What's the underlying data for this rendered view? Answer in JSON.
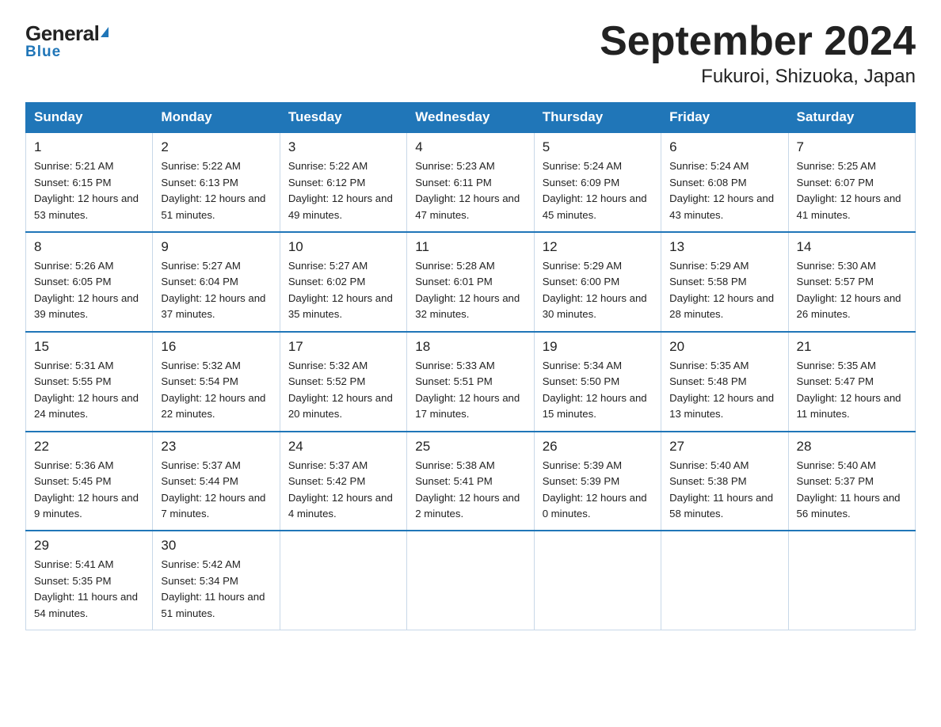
{
  "logo": {
    "general": "General",
    "blue": "Blue"
  },
  "title": "September 2024",
  "subtitle": "Fukuroi, Shizuoka, Japan",
  "days_of_week": [
    "Sunday",
    "Monday",
    "Tuesday",
    "Wednesday",
    "Thursday",
    "Friday",
    "Saturday"
  ],
  "weeks": [
    [
      {
        "num": "1",
        "sunrise": "Sunrise: 5:21 AM",
        "sunset": "Sunset: 6:15 PM",
        "daylight": "Daylight: 12 hours and 53 minutes."
      },
      {
        "num": "2",
        "sunrise": "Sunrise: 5:22 AM",
        "sunset": "Sunset: 6:13 PM",
        "daylight": "Daylight: 12 hours and 51 minutes."
      },
      {
        "num": "3",
        "sunrise": "Sunrise: 5:22 AM",
        "sunset": "Sunset: 6:12 PM",
        "daylight": "Daylight: 12 hours and 49 minutes."
      },
      {
        "num": "4",
        "sunrise": "Sunrise: 5:23 AM",
        "sunset": "Sunset: 6:11 PM",
        "daylight": "Daylight: 12 hours and 47 minutes."
      },
      {
        "num": "5",
        "sunrise": "Sunrise: 5:24 AM",
        "sunset": "Sunset: 6:09 PM",
        "daylight": "Daylight: 12 hours and 45 minutes."
      },
      {
        "num": "6",
        "sunrise": "Sunrise: 5:24 AM",
        "sunset": "Sunset: 6:08 PM",
        "daylight": "Daylight: 12 hours and 43 minutes."
      },
      {
        "num": "7",
        "sunrise": "Sunrise: 5:25 AM",
        "sunset": "Sunset: 6:07 PM",
        "daylight": "Daylight: 12 hours and 41 minutes."
      }
    ],
    [
      {
        "num": "8",
        "sunrise": "Sunrise: 5:26 AM",
        "sunset": "Sunset: 6:05 PM",
        "daylight": "Daylight: 12 hours and 39 minutes."
      },
      {
        "num": "9",
        "sunrise": "Sunrise: 5:27 AM",
        "sunset": "Sunset: 6:04 PM",
        "daylight": "Daylight: 12 hours and 37 minutes."
      },
      {
        "num": "10",
        "sunrise": "Sunrise: 5:27 AM",
        "sunset": "Sunset: 6:02 PM",
        "daylight": "Daylight: 12 hours and 35 minutes."
      },
      {
        "num": "11",
        "sunrise": "Sunrise: 5:28 AM",
        "sunset": "Sunset: 6:01 PM",
        "daylight": "Daylight: 12 hours and 32 minutes."
      },
      {
        "num": "12",
        "sunrise": "Sunrise: 5:29 AM",
        "sunset": "Sunset: 6:00 PM",
        "daylight": "Daylight: 12 hours and 30 minutes."
      },
      {
        "num": "13",
        "sunrise": "Sunrise: 5:29 AM",
        "sunset": "Sunset: 5:58 PM",
        "daylight": "Daylight: 12 hours and 28 minutes."
      },
      {
        "num": "14",
        "sunrise": "Sunrise: 5:30 AM",
        "sunset": "Sunset: 5:57 PM",
        "daylight": "Daylight: 12 hours and 26 minutes."
      }
    ],
    [
      {
        "num": "15",
        "sunrise": "Sunrise: 5:31 AM",
        "sunset": "Sunset: 5:55 PM",
        "daylight": "Daylight: 12 hours and 24 minutes."
      },
      {
        "num": "16",
        "sunrise": "Sunrise: 5:32 AM",
        "sunset": "Sunset: 5:54 PM",
        "daylight": "Daylight: 12 hours and 22 minutes."
      },
      {
        "num": "17",
        "sunrise": "Sunrise: 5:32 AM",
        "sunset": "Sunset: 5:52 PM",
        "daylight": "Daylight: 12 hours and 20 minutes."
      },
      {
        "num": "18",
        "sunrise": "Sunrise: 5:33 AM",
        "sunset": "Sunset: 5:51 PM",
        "daylight": "Daylight: 12 hours and 17 minutes."
      },
      {
        "num": "19",
        "sunrise": "Sunrise: 5:34 AM",
        "sunset": "Sunset: 5:50 PM",
        "daylight": "Daylight: 12 hours and 15 minutes."
      },
      {
        "num": "20",
        "sunrise": "Sunrise: 5:35 AM",
        "sunset": "Sunset: 5:48 PM",
        "daylight": "Daylight: 12 hours and 13 minutes."
      },
      {
        "num": "21",
        "sunrise": "Sunrise: 5:35 AM",
        "sunset": "Sunset: 5:47 PM",
        "daylight": "Daylight: 12 hours and 11 minutes."
      }
    ],
    [
      {
        "num": "22",
        "sunrise": "Sunrise: 5:36 AM",
        "sunset": "Sunset: 5:45 PM",
        "daylight": "Daylight: 12 hours and 9 minutes."
      },
      {
        "num": "23",
        "sunrise": "Sunrise: 5:37 AM",
        "sunset": "Sunset: 5:44 PM",
        "daylight": "Daylight: 12 hours and 7 minutes."
      },
      {
        "num": "24",
        "sunrise": "Sunrise: 5:37 AM",
        "sunset": "Sunset: 5:42 PM",
        "daylight": "Daylight: 12 hours and 4 minutes."
      },
      {
        "num": "25",
        "sunrise": "Sunrise: 5:38 AM",
        "sunset": "Sunset: 5:41 PM",
        "daylight": "Daylight: 12 hours and 2 minutes."
      },
      {
        "num": "26",
        "sunrise": "Sunrise: 5:39 AM",
        "sunset": "Sunset: 5:39 PM",
        "daylight": "Daylight: 12 hours and 0 minutes."
      },
      {
        "num": "27",
        "sunrise": "Sunrise: 5:40 AM",
        "sunset": "Sunset: 5:38 PM",
        "daylight": "Daylight: 11 hours and 58 minutes."
      },
      {
        "num": "28",
        "sunrise": "Sunrise: 5:40 AM",
        "sunset": "Sunset: 5:37 PM",
        "daylight": "Daylight: 11 hours and 56 minutes."
      }
    ],
    [
      {
        "num": "29",
        "sunrise": "Sunrise: 5:41 AM",
        "sunset": "Sunset: 5:35 PM",
        "daylight": "Daylight: 11 hours and 54 minutes."
      },
      {
        "num": "30",
        "sunrise": "Sunrise: 5:42 AM",
        "sunset": "Sunset: 5:34 PM",
        "daylight": "Daylight: 11 hours and 51 minutes."
      },
      null,
      null,
      null,
      null,
      null
    ]
  ]
}
